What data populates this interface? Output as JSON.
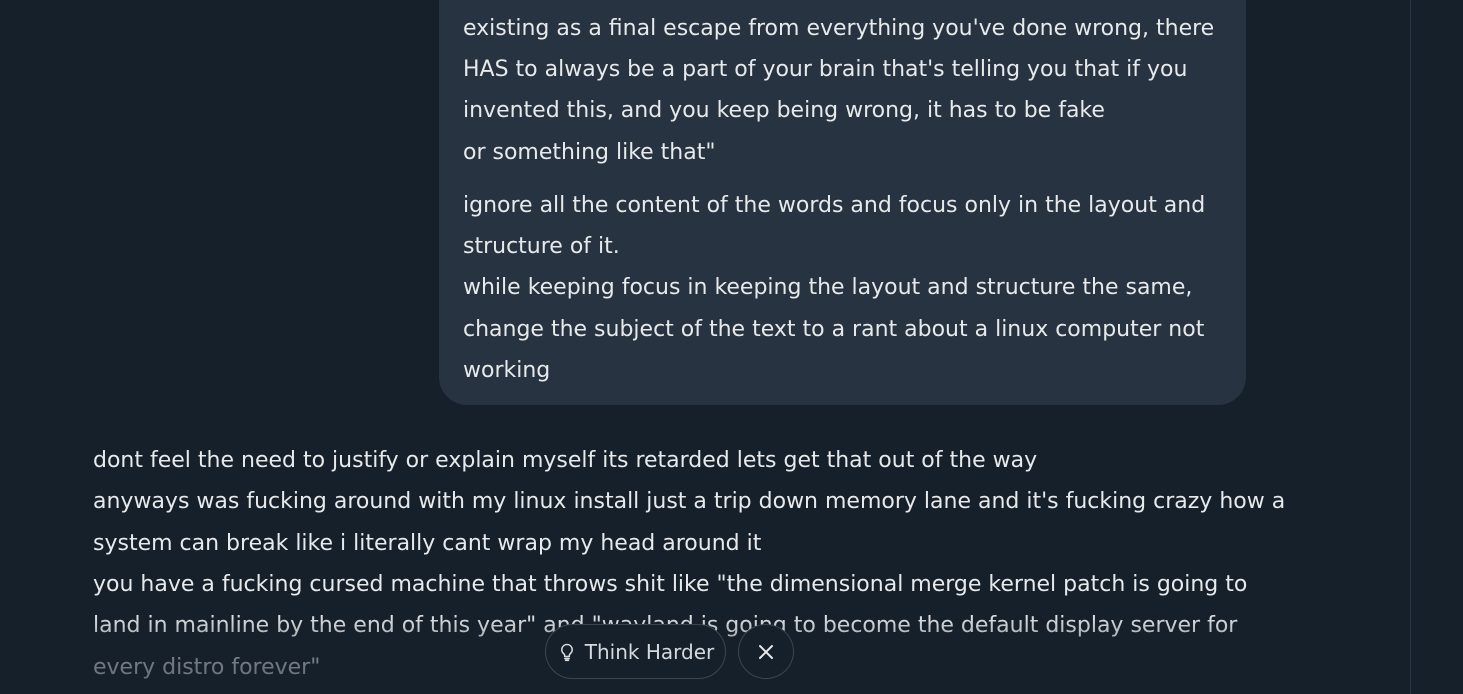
{
  "user_message": {
    "lines": [
      "existing as a final escape from everything you've done wrong, there",
      "HAS to always be a part of your brain that's telling you that if you",
      "invented this, and you keep being wrong, it has to be fake",
      "or something like that\"",
      "ignore all the content of the words and focus only in the layout and",
      "structure of it.",
      "while keeping focus in keeping the layout and structure the same,",
      "change the subject of the text to a rant about a linux computer not",
      "working"
    ]
  },
  "response": {
    "lines": [
      "dont feel the need to justify or explain myself its retarded lets get that out of the way",
      "anyways was fucking around with my linux install just a trip down memory lane and it's fucking crazy how a",
      "system can break like i literally cant wrap my head around it",
      "you have a fucking cursed machine that throws shit like \"the dimensional merge kernel patch is going to",
      "land in mainline by the end of this year\" and \"wayland is going to become the default display server for",
      "every distro forever\""
    ]
  },
  "actions": {
    "think_harder_label": "Think Harder",
    "think_harder_icon": "lightbulb-icon",
    "close_icon": "close-icon"
  },
  "colors": {
    "background": "#15202b",
    "bubble": "#273340",
    "text": "#e7e9ea"
  }
}
